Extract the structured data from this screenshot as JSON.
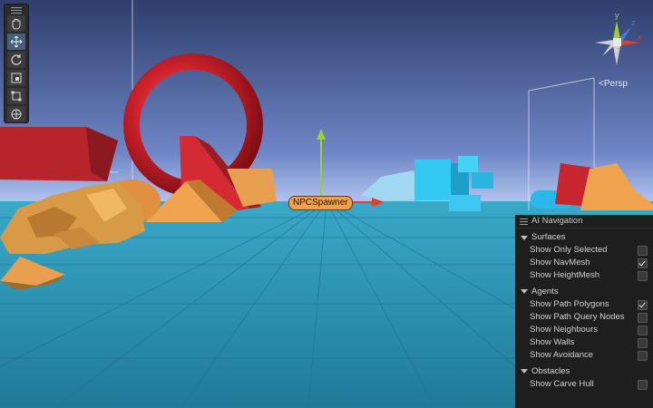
{
  "scene": {
    "camera_label": "Persp",
    "npc_label": "NPCSpawner",
    "gizmo_axes": {
      "y": "y",
      "x": "x",
      "z": "z"
    }
  },
  "toolbar": {
    "tools": [
      {
        "icon": "hand-icon",
        "active": false
      },
      {
        "icon": "move-icon",
        "active": true
      },
      {
        "icon": "rotate-icon",
        "active": false
      },
      {
        "icon": "scale-icon",
        "active": false
      },
      {
        "icon": "rect-tool-icon",
        "active": false
      },
      {
        "icon": "transform-icon",
        "active": false
      }
    ]
  },
  "ai_navigation": {
    "title": "AI Navigation",
    "sections": [
      {
        "label": "Surfaces",
        "items": [
          {
            "label": "Show Only Selected",
            "checked": false
          },
          {
            "label": "Show NavMesh",
            "checked": true
          },
          {
            "label": "Show HeightMesh",
            "checked": false
          }
        ]
      },
      {
        "label": "Agents",
        "items": [
          {
            "label": "Show Path Polygons",
            "checked": true
          },
          {
            "label": "Show Path Query Nodes",
            "checked": false
          },
          {
            "label": "Show Neighbours",
            "checked": false
          },
          {
            "label": "Show Walls",
            "checked": false
          },
          {
            "label": "Show Avoidance",
            "checked": false
          }
        ]
      },
      {
        "label": "Obstacles",
        "items": [
          {
            "label": "Show Carve Hull",
            "checked": false
          }
        ]
      }
    ]
  },
  "colors": {
    "sky_top": "#3a4a7a",
    "sky_horizon": "#9fb4e8",
    "floor": "#2a8aa8",
    "ring": "#c81e28",
    "sand": "#f0a450",
    "cyan_box": "#30c8f0"
  }
}
